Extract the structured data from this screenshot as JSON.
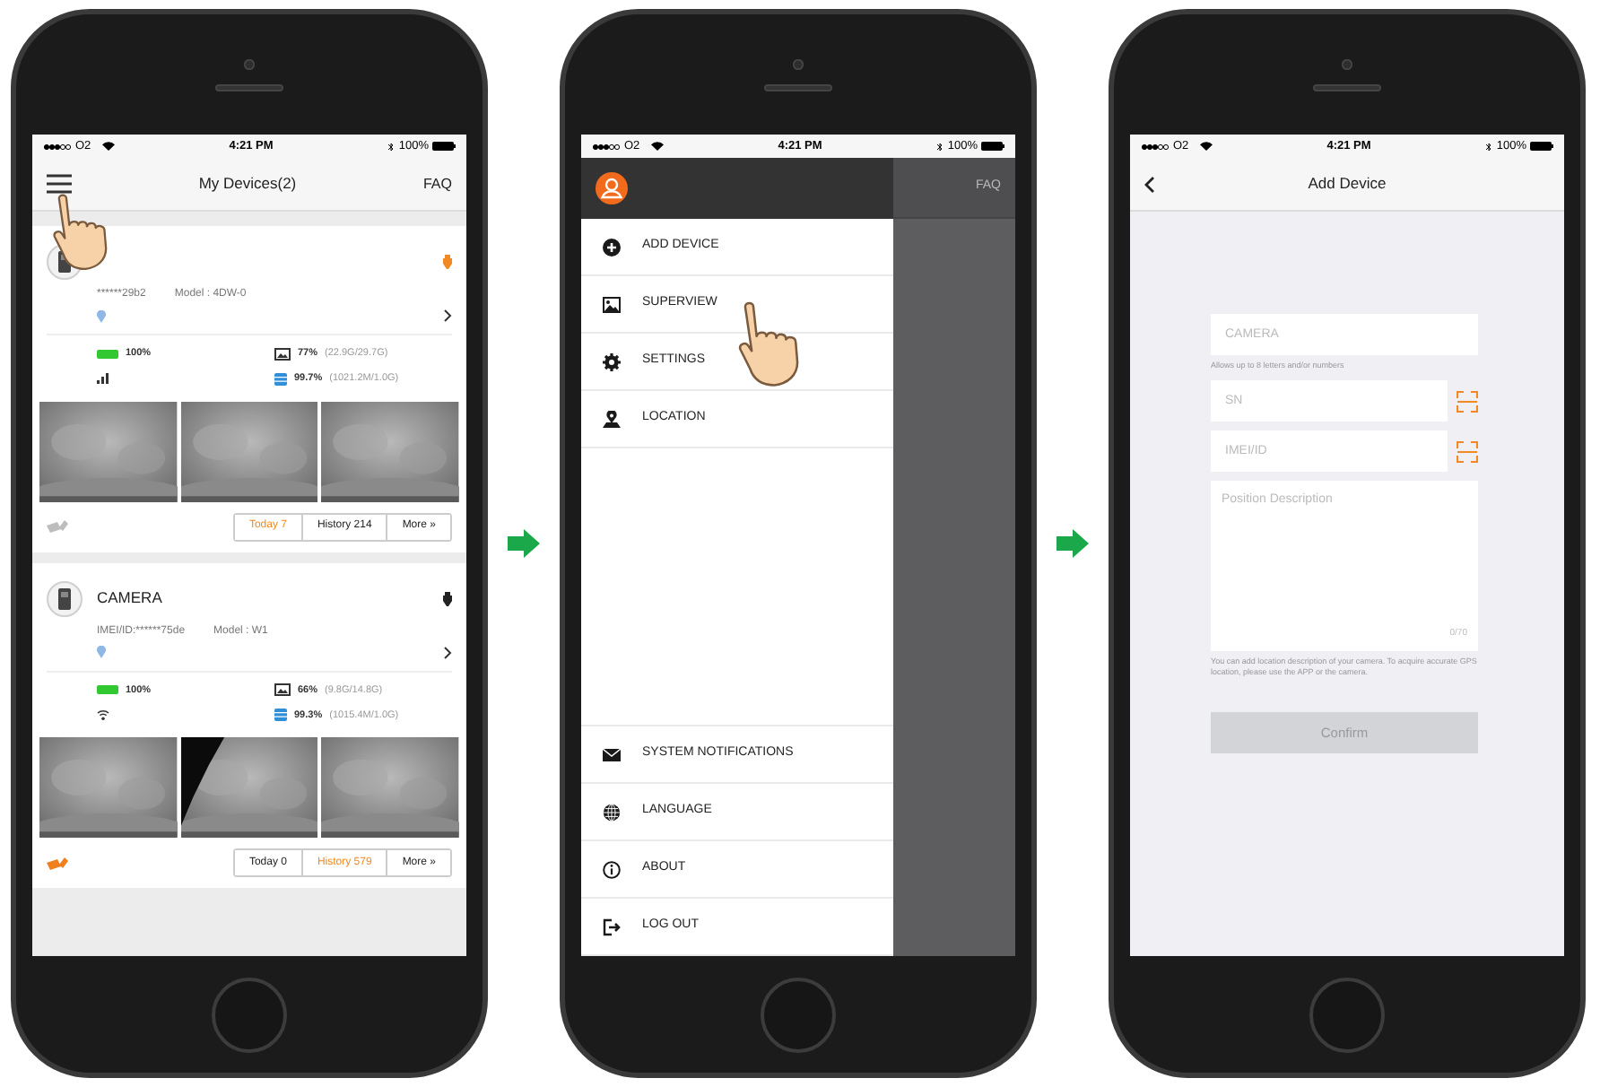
{
  "phones": [
    {
      "kind": "devices",
      "pointer": true,
      "status_bar": {
        "carrier": "O2",
        "time": "4:21 PM",
        "battery": "100%"
      },
      "nav": {
        "title": "My Devices(2)",
        "action": "FAQ"
      },
      "devices": [
        {
          "kind": "cellular",
          "imei": "******29b2",
          "model": "Model : 4DW-0",
          "color": "#f08a24",
          "status_active": false,
          "battery": "100%",
          "storage_pct": "77%",
          "storage_detail": "(22.9G/29.7G)",
          "data_pct": "99.7%",
          "data_detail": "(1021.2M/1.0G)",
          "buttons": [
            {
              "label": "Today 7",
              "selected": true
            },
            {
              "label": "History 214",
              "selected": false
            },
            {
              "label": "More »",
              "selected": false
            }
          ]
        },
        {
          "kind": "wifi",
          "name": "CAMERA",
          "imei": "IMEI/ID:******75de",
          "model": "Model : W1",
          "color": "#222222",
          "status_active": true,
          "battery": "100%",
          "storage_pct": "66%",
          "storage_detail": "(9.8G/14.8G)",
          "data_pct": "99.3%",
          "data_detail": "(1015.4M/1.0G)",
          "buttons": [
            {
              "label": "Today 0",
              "selected": false
            },
            {
              "label": "History 579",
              "selected": true
            },
            {
              "label": "More »",
              "selected": false
            }
          ]
        }
      ]
    },
    {
      "kind": "menu",
      "pointer": true,
      "status_bar": {
        "carrier": "O2",
        "time": "4:21 PM",
        "battery": "100%"
      },
      "behind_action": "FAQ",
      "top_items": [
        "ADD DEVICE",
        "SUPERVIEW",
        "SETTINGS",
        "LOCATION"
      ],
      "bottom_items": [
        "SYSTEM NOTIFICATIONS",
        "LANGUAGE",
        "ABOUT",
        "LOG OUT"
      ]
    },
    {
      "kind": "add_device",
      "pointer": false,
      "status_bar": {
        "carrier": "O2",
        "time": "4:21 PM",
        "battery": "100%"
      },
      "nav": {
        "title": "Add Device"
      },
      "fields": [
        {
          "kind": "text",
          "placeholder": "CAMERA",
          "hint": "Allows up to 8 letters and/or numbers"
        },
        {
          "kind": "scan",
          "placeholder": "SN"
        },
        {
          "kind": "scan",
          "placeholder": "IMEI/ID"
        },
        {
          "kind": "area",
          "placeholder": "Position Description",
          "counter": "0/70",
          "hint": "You can add location description of your camera. To acquire accurate GPS location, please use the APP or the camera."
        }
      ],
      "confirm": {
        "label": "Confirm",
        "disabled": true
      }
    }
  ]
}
